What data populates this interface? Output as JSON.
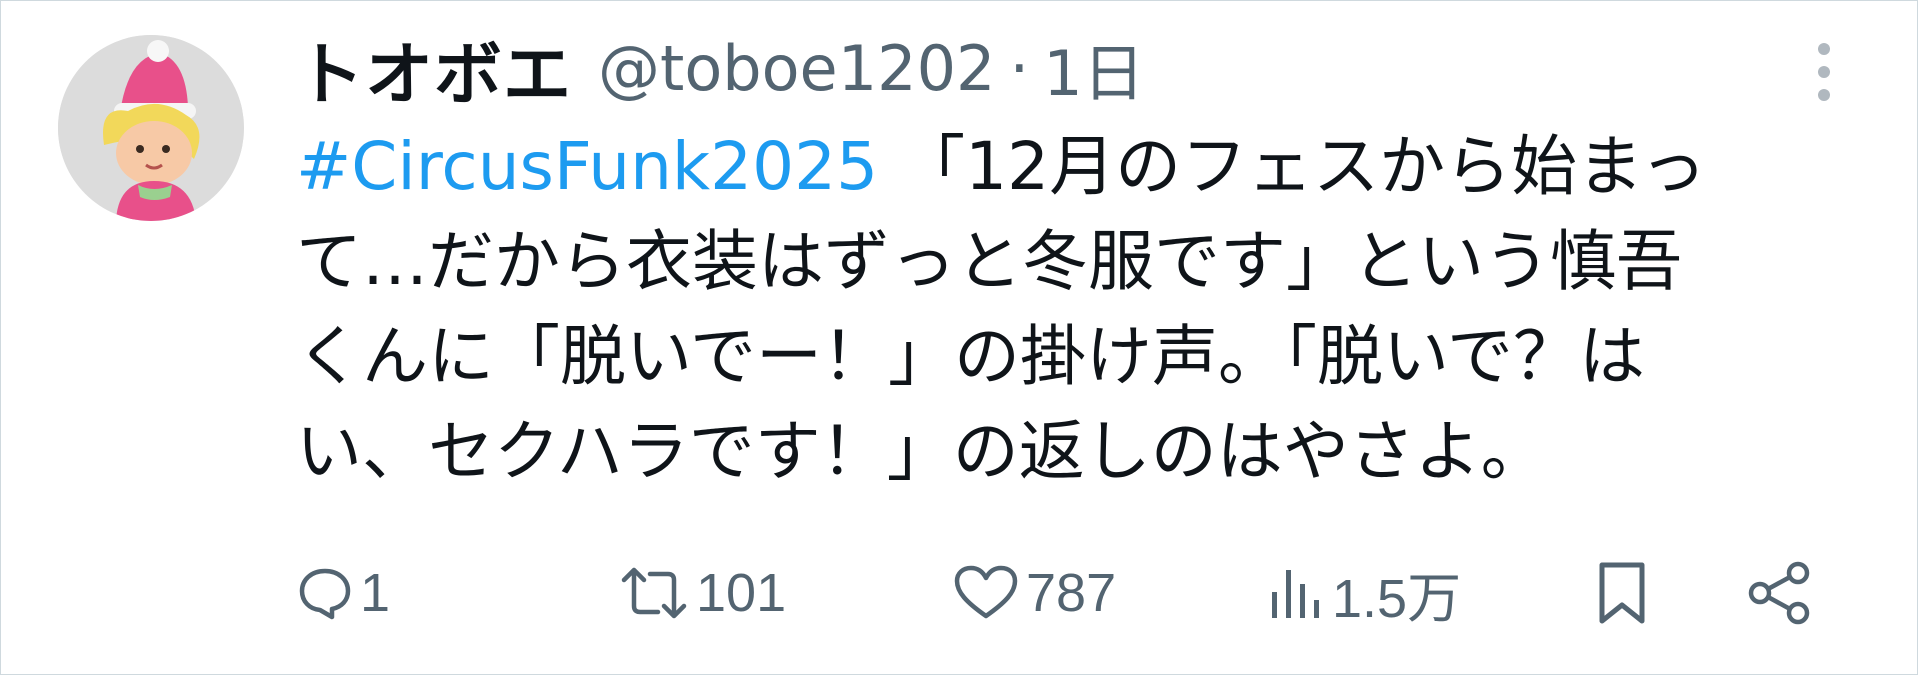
{
  "tweet": {
    "display_name": "トオボエ",
    "handle": "@toboe1202",
    "separator": "·",
    "time": "1日",
    "hashtag": "#CircusFunk2025",
    "text_line1": " 「12月のフェスから始まっ",
    "text_line2": "て…だから衣装はずっと冬服です」という慎吾",
    "text_line3": "くんに「脱いでー！」の掛け声。「脱いで？は",
    "text_line4": "い、セクハラです！」の返しのはやさよ。"
  },
  "actions": {
    "reply_count": "1",
    "retweet_count": "101",
    "like_count": "787",
    "views_count": "1.5万"
  },
  "icons": {
    "more": "more-vertical-icon",
    "reply": "reply-icon",
    "retweet": "retweet-icon",
    "like": "heart-icon",
    "views": "views-bar-chart-icon",
    "bookmark": "bookmark-icon",
    "share": "share-icon"
  },
  "colors": {
    "text": "#0f1419",
    "muted": "#536471",
    "link": "#1d9bf0"
  }
}
